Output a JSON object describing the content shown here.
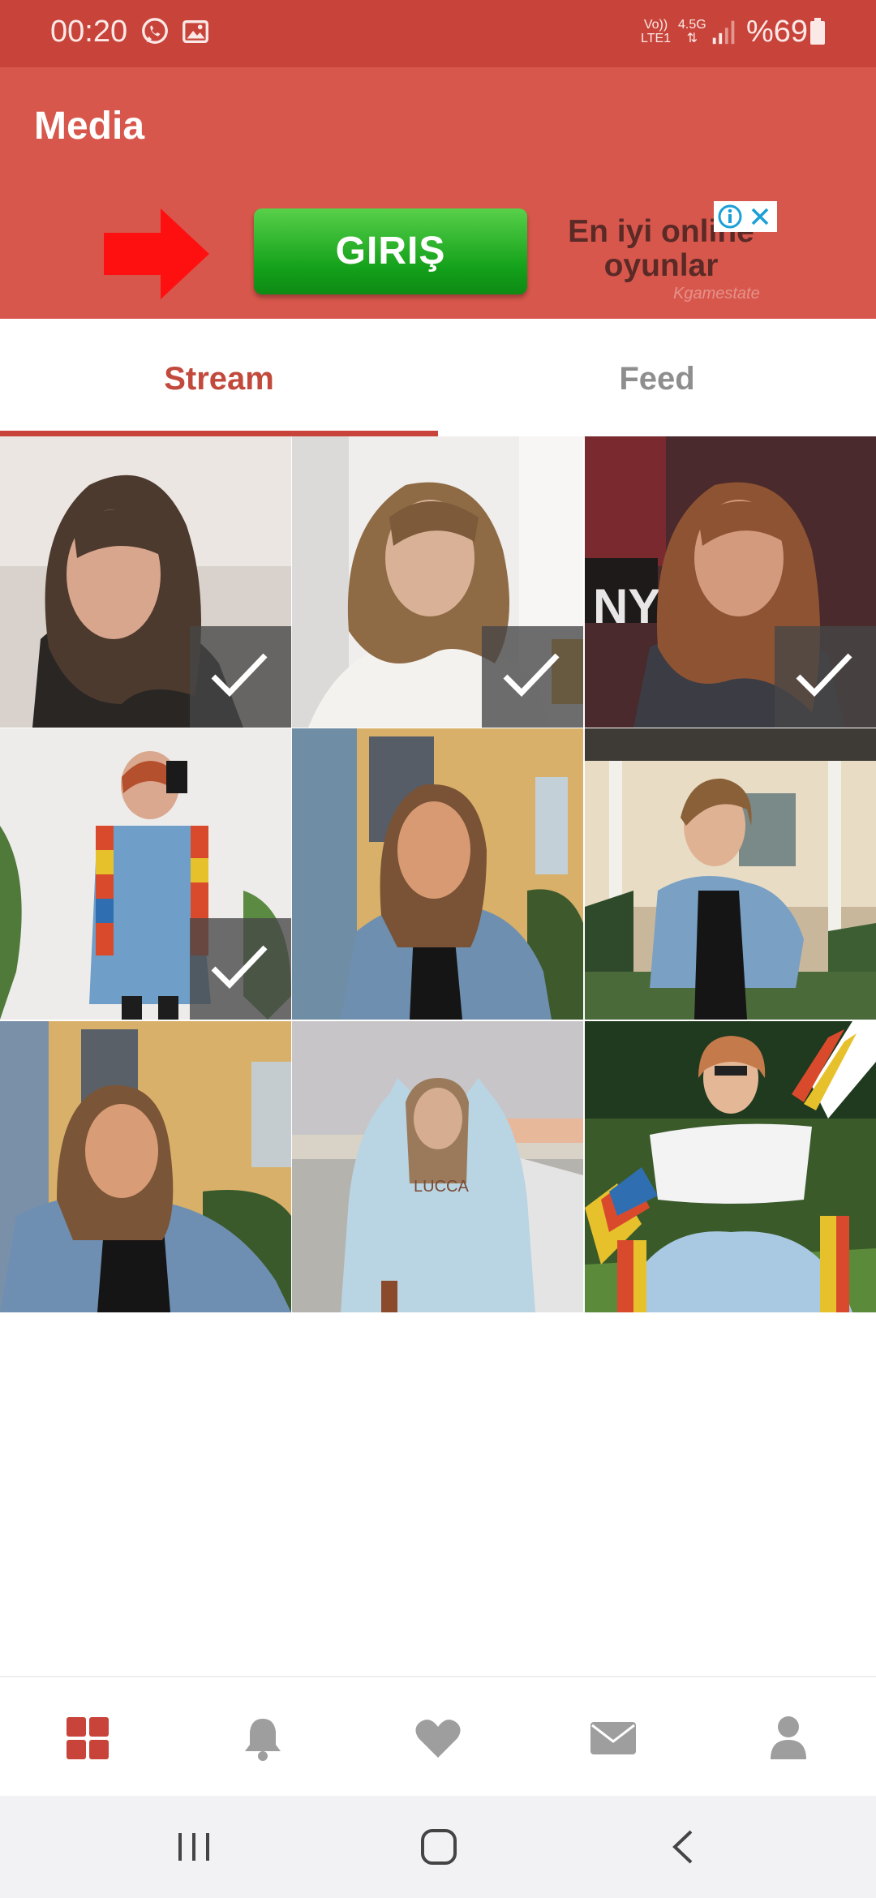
{
  "status_bar": {
    "time": "00:20",
    "notification_icons": [
      "whatsapp-icon",
      "gallery-icon"
    ],
    "network_top": "Vo))",
    "network_bottom": "LTE1",
    "network_type": "4.5G",
    "battery": "%69"
  },
  "app_bar": {
    "title": "Media"
  },
  "ad": {
    "button_label": "GIRIŞ",
    "text": "En iyi online oyunlar",
    "source": "Kgamestate"
  },
  "tabs": [
    {
      "label": "Stream",
      "selected": true
    },
    {
      "label": "Feed",
      "selected": false
    }
  ],
  "photos": [
    {
      "checked": true
    },
    {
      "checked": true
    },
    {
      "checked": true
    },
    {
      "checked": true
    },
    {
      "checked": false
    },
    {
      "checked": false
    },
    {
      "checked": false
    },
    {
      "checked": false
    },
    {
      "checked": false
    }
  ],
  "bottom_nav": [
    {
      "icon": "grid-icon",
      "active": true
    },
    {
      "icon": "bell-icon",
      "active": false
    },
    {
      "icon": "heart-icon",
      "active": false
    },
    {
      "icon": "mail-icon",
      "active": false
    },
    {
      "icon": "user-icon",
      "active": false
    }
  ],
  "colors": {
    "accent": "#c8443a",
    "app_bar": "#d8574c",
    "inactive_icon": "#9e9e9e"
  }
}
